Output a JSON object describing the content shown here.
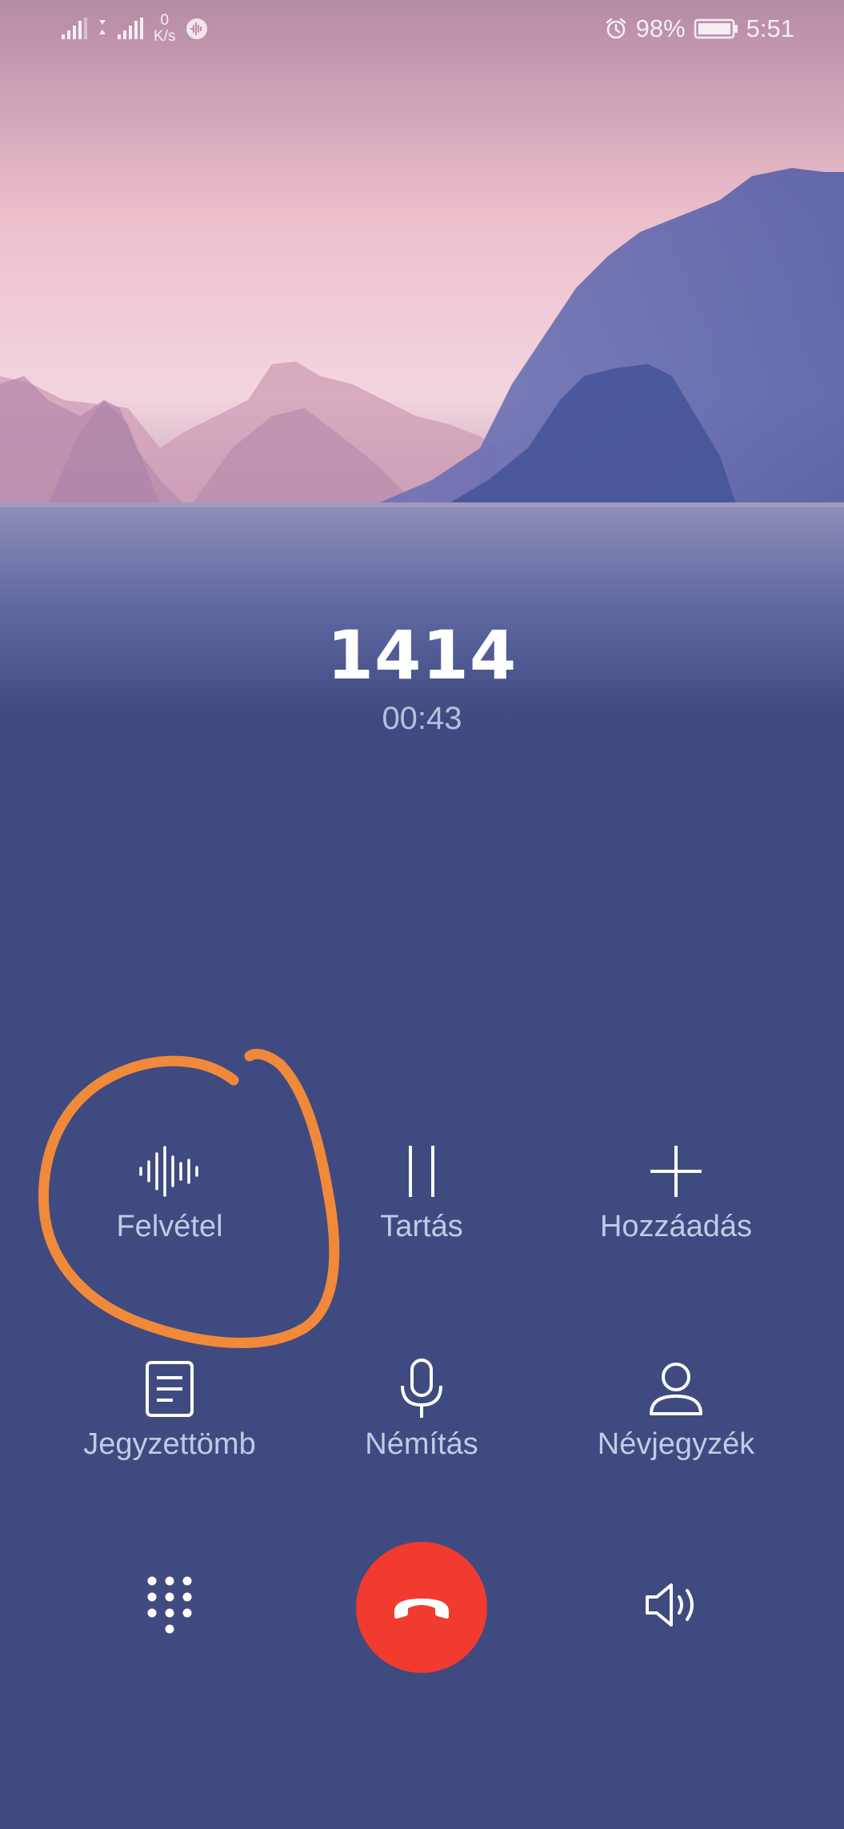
{
  "status_bar": {
    "network_speed_value": "0",
    "network_speed_unit": "K/s",
    "battery": "98%",
    "time": "5:51"
  },
  "call": {
    "number": "1414",
    "duration": "00:43"
  },
  "actions": {
    "record": "Felvétel",
    "hold": "Tartás",
    "add": "Hozzáadás",
    "notepad": "Jegyzettömb",
    "mute": "Némítás",
    "contacts": "Névjegyzék"
  },
  "icons": {
    "record": "waveform-icon",
    "hold": "pause-icon",
    "add": "plus-icon",
    "notepad": "notepad-icon",
    "mute": "microphone-icon",
    "contacts": "person-icon",
    "dialpad": "dialpad-icon",
    "end_call": "phone-hangup-icon",
    "speaker": "speaker-icon"
  },
  "colors": {
    "background": "#3f4a80",
    "end_call": "#f03b2e",
    "annotation_circle": "#f0893a"
  }
}
